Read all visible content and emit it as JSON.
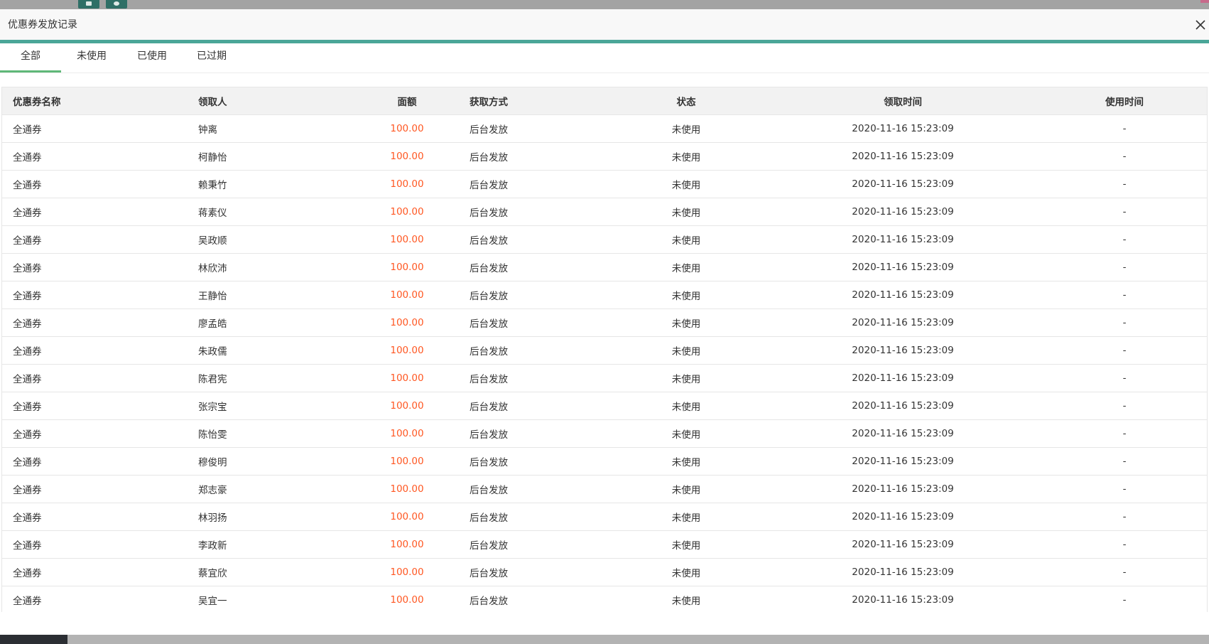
{
  "modal": {
    "title": "优惠券发放记录"
  },
  "tabs": [
    {
      "label": "全部",
      "active": true
    },
    {
      "label": "未使用",
      "active": false
    },
    {
      "label": "已使用",
      "active": false
    },
    {
      "label": "已过期",
      "active": false
    }
  ],
  "table": {
    "headers": {
      "name": "优惠券名称",
      "user": "领取人",
      "amount": "面额",
      "method": "获取方式",
      "status": "状态",
      "time": "领取时间",
      "used_time": "使用时间"
    },
    "rows": [
      {
        "name": "全通券",
        "user": "钟离",
        "amount": "100.00",
        "method": "后台发放",
        "status": "未使用",
        "time": "2020-11-16 15:23:09",
        "used_time": "-"
      },
      {
        "name": "全通券",
        "user": "柯静怡",
        "amount": "100.00",
        "method": "后台发放",
        "status": "未使用",
        "time": "2020-11-16 15:23:09",
        "used_time": "-"
      },
      {
        "name": "全通券",
        "user": "赖秉竹",
        "amount": "100.00",
        "method": "后台发放",
        "status": "未使用",
        "time": "2020-11-16 15:23:09",
        "used_time": "-"
      },
      {
        "name": "全通券",
        "user": "蒋素仪",
        "amount": "100.00",
        "method": "后台发放",
        "status": "未使用",
        "time": "2020-11-16 15:23:09",
        "used_time": "-"
      },
      {
        "name": "全通券",
        "user": "吴政顺",
        "amount": "100.00",
        "method": "后台发放",
        "status": "未使用",
        "time": "2020-11-16 15:23:09",
        "used_time": "-"
      },
      {
        "name": "全通券",
        "user": "林欣沛",
        "amount": "100.00",
        "method": "后台发放",
        "status": "未使用",
        "time": "2020-11-16 15:23:09",
        "used_time": "-"
      },
      {
        "name": "全通券",
        "user": "王静怡",
        "amount": "100.00",
        "method": "后台发放",
        "status": "未使用",
        "time": "2020-11-16 15:23:09",
        "used_time": "-"
      },
      {
        "name": "全通券",
        "user": "廖孟皓",
        "amount": "100.00",
        "method": "后台发放",
        "status": "未使用",
        "time": "2020-11-16 15:23:09",
        "used_time": "-"
      },
      {
        "name": "全通券",
        "user": "朱政儒",
        "amount": "100.00",
        "method": "后台发放",
        "status": "未使用",
        "time": "2020-11-16 15:23:09",
        "used_time": "-"
      },
      {
        "name": "全通券",
        "user": "陈君宪",
        "amount": "100.00",
        "method": "后台发放",
        "status": "未使用",
        "time": "2020-11-16 15:23:09",
        "used_time": "-"
      },
      {
        "name": "全通券",
        "user": "张宗宝",
        "amount": "100.00",
        "method": "后台发放",
        "status": "未使用",
        "time": "2020-11-16 15:23:09",
        "used_time": "-"
      },
      {
        "name": "全通券",
        "user": "陈怡雯",
        "amount": "100.00",
        "method": "后台发放",
        "status": "未使用",
        "time": "2020-11-16 15:23:09",
        "used_time": "-"
      },
      {
        "name": "全通券",
        "user": "穆俊明",
        "amount": "100.00",
        "method": "后台发放",
        "status": "未使用",
        "time": "2020-11-16 15:23:09",
        "used_time": "-"
      },
      {
        "name": "全通券",
        "user": "郑志豪",
        "amount": "100.00",
        "method": "后台发放",
        "status": "未使用",
        "time": "2020-11-16 15:23:09",
        "used_time": "-"
      },
      {
        "name": "全通券",
        "user": "林羽扬",
        "amount": "100.00",
        "method": "后台发放",
        "status": "未使用",
        "time": "2020-11-16 15:23:09",
        "used_time": "-"
      },
      {
        "name": "全通券",
        "user": "李政新",
        "amount": "100.00",
        "method": "后台发放",
        "status": "未使用",
        "time": "2020-11-16 15:23:09",
        "used_time": "-"
      },
      {
        "name": "全通券",
        "user": "蔡宜欣",
        "amount": "100.00",
        "method": "后台发放",
        "status": "未使用",
        "time": "2020-11-16 15:23:09",
        "used_time": "-"
      },
      {
        "name": "全通券",
        "user": "吴宜一",
        "amount": "100.00",
        "method": "后台发放",
        "status": "未使用",
        "time": "2020-11-16 15:23:09",
        "used_time": "-"
      }
    ]
  },
  "colors": {
    "accent": "#4aa698",
    "tab_active": "#5fb878",
    "amount": "#ff5722"
  },
  "icons": {
    "close": "close-icon"
  }
}
